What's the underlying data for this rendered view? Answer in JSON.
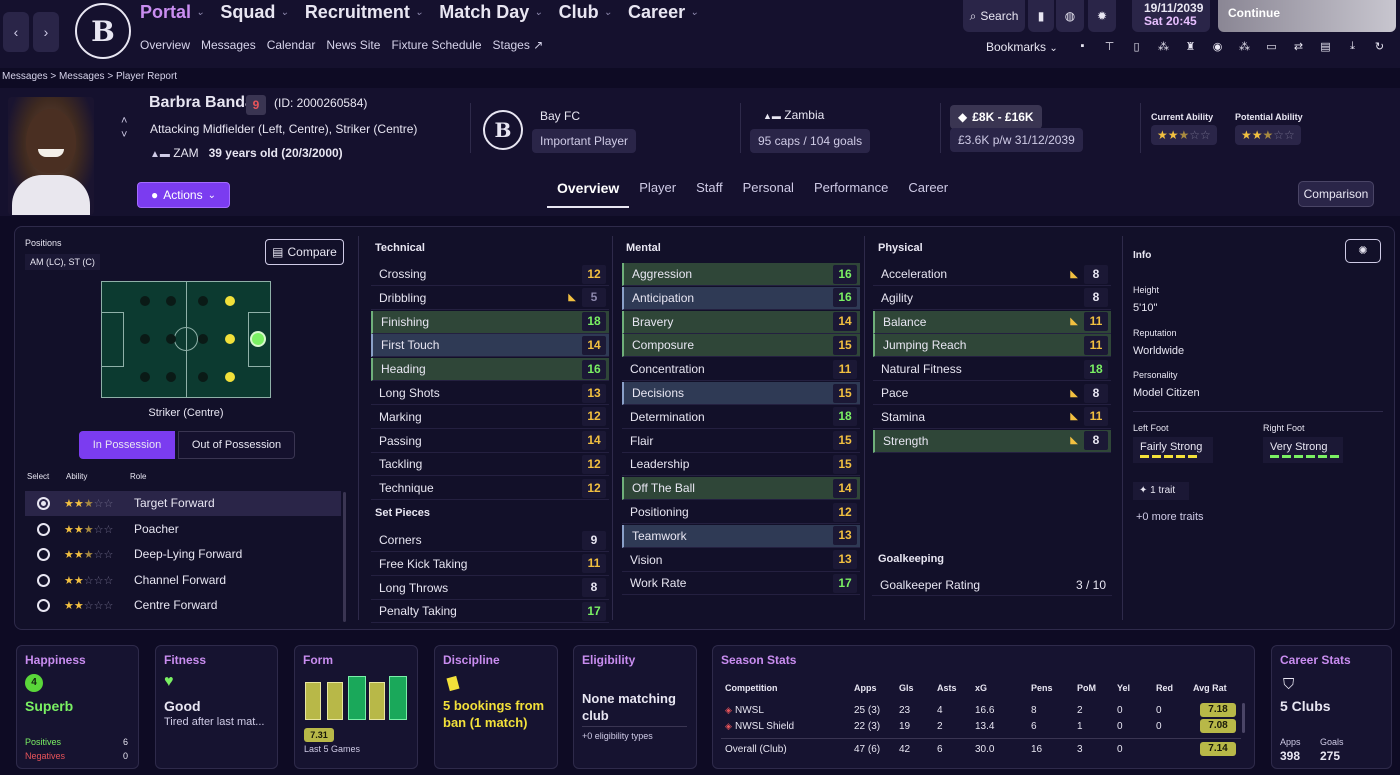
{
  "nav": {
    "main": [
      "Portal",
      "Squad",
      "Recruitment",
      "Match Day",
      "Club",
      "Career"
    ],
    "sub": [
      "Overview",
      "Messages",
      "Calendar",
      "News Site",
      "Fixture Schedule",
      "Stages"
    ],
    "search": "Search",
    "date": "19/11/2039",
    "day_time": "Sat 20:45",
    "continue": "Continue",
    "bookmarks": "Bookmarks",
    "breadcrumb": "Messages  >  Messages  >  Player Report",
    "club_logo": "B"
  },
  "player": {
    "name": "Barbra Banda",
    "number": "9",
    "id": "(ID: 2000260584)",
    "positions": "Attacking Midfielder (Left, Centre), Striker (Centre)",
    "nation_code": "ZAM",
    "age": "39 years old (20/3/2000)",
    "club": "Bay FC",
    "status": "Important Player",
    "nation": "Zambia",
    "caps": "95 caps / 104 goals",
    "value": "£8K - £16K",
    "wage": "£3.6K p/w 31/12/2039",
    "ca_label": "Current Ability",
    "pa_label": "Potential Ability",
    "ca_stars": 2.5,
    "pa_stars": 2.5
  },
  "actions": "Actions",
  "tabs": [
    "Overview",
    "Player",
    "Staff",
    "Personal",
    "Performance",
    "Career"
  ],
  "comparison": "Comparison",
  "positions_panel": {
    "title": "Positions",
    "code": "AM (LC), ST (C)",
    "compare": "Compare",
    "selected": "Striker (Centre)",
    "in_possession": "In Possession",
    "out_possession": "Out of Possession",
    "col_select": "Select",
    "col_ability": "Ability",
    "col_role": "Role",
    "roles": [
      {
        "name": "Target Forward",
        "stars": 2.5,
        "selected": true
      },
      {
        "name": "Poacher",
        "stars": 2.5,
        "selected": false
      },
      {
        "name": "Deep-Lying Forward",
        "stars": 2.5,
        "selected": false
      },
      {
        "name": "Channel Forward",
        "stars": 2,
        "selected": false
      },
      {
        "name": "Centre Forward",
        "stars": 2,
        "selected": false
      }
    ]
  },
  "technical": {
    "title": "Technical",
    "rows": [
      [
        "Crossing",
        "12"
      ],
      [
        "Dribbling",
        "5"
      ],
      [
        "Finishing",
        "18"
      ],
      [
        "First Touch",
        "14"
      ],
      [
        "Heading",
        "16"
      ],
      [
        "Long Shots",
        "13"
      ],
      [
        "Marking",
        "12"
      ],
      [
        "Passing",
        "14"
      ],
      [
        "Tackling",
        "12"
      ],
      [
        "Technique",
        "12"
      ]
    ]
  },
  "set_pieces": {
    "title": "Set Pieces",
    "rows": [
      [
        "Corners",
        "9"
      ],
      [
        "Free Kick Taking",
        "11"
      ],
      [
        "Long Throws",
        "8"
      ],
      [
        "Penalty Taking",
        "17"
      ]
    ]
  },
  "mental": {
    "title": "Mental",
    "rows": [
      [
        "Aggression",
        "16"
      ],
      [
        "Anticipation",
        "16"
      ],
      [
        "Bravery",
        "14"
      ],
      [
        "Composure",
        "15"
      ],
      [
        "Concentration",
        "11"
      ],
      [
        "Decisions",
        "15"
      ],
      [
        "Determination",
        "18"
      ],
      [
        "Flair",
        "15"
      ],
      [
        "Leadership",
        "15"
      ],
      [
        "Off The Ball",
        "14"
      ],
      [
        "Positioning",
        "12"
      ],
      [
        "Teamwork",
        "13"
      ],
      [
        "Vision",
        "13"
      ],
      [
        "Work Rate",
        "17"
      ]
    ]
  },
  "physical": {
    "title": "Physical",
    "rows": [
      [
        "Acceleration",
        "8"
      ],
      [
        "Agility",
        "8"
      ],
      [
        "Balance",
        "11"
      ],
      [
        "Jumping Reach",
        "11"
      ],
      [
        "Natural Fitness",
        "18"
      ],
      [
        "Pace",
        "8"
      ],
      [
        "Stamina",
        "11"
      ],
      [
        "Strength",
        "8"
      ]
    ]
  },
  "goalkeeping": {
    "title": "Goalkeeping",
    "label": "Goalkeeper Rating",
    "value": "3 / 10"
  },
  "info": {
    "title": "Info",
    "height_label": "Height",
    "height": "5'10\"",
    "rep_label": "Reputation",
    "rep": "Worldwide",
    "pers_label": "Personality",
    "pers": "Model Citizen",
    "lf_label": "Left Foot",
    "lf": "Fairly Strong",
    "rf_label": "Right Foot",
    "rf": "Very Strong",
    "trait": "1 trait",
    "more_traits": "+0 more traits"
  },
  "cards": {
    "happiness": {
      "title": "Happiness",
      "value": "Superb",
      "icon_text": "4",
      "pos_label": "Positives",
      "pos": "6",
      "neg_label": "Negatives",
      "neg": "0"
    },
    "fitness": {
      "title": "Fitness",
      "value": "Good",
      "sub": "Tired after last mat..."
    },
    "form": {
      "title": "Form",
      "rating": "7.31",
      "sub": "Last 5 Games"
    },
    "discipline": {
      "title": "Discipline",
      "value": "5 bookings from ban (1 match)"
    },
    "eligibility": {
      "title": "Eligibility",
      "value": "None matching club",
      "sub": "+0 eligibility types"
    },
    "season": {
      "title": "Season Stats",
      "headers": [
        "Competition",
        "Apps",
        "Gls",
        "Asts",
        "xG",
        "Pens",
        "PoM",
        "Yel",
        "Red",
        "Avg Rat"
      ],
      "rows": [
        [
          "NWSL",
          "25 (3)",
          "23",
          "4",
          "16.6",
          "8",
          "2",
          "0",
          "0",
          "7.18"
        ],
        [
          "NWSL Shield",
          "22 (3)",
          "19",
          "2",
          "13.4",
          "6",
          "1",
          "0",
          "0",
          "7.08"
        ],
        [
          "Overall (Club)",
          "47 (6)",
          "42",
          "6",
          "30.0",
          "16",
          "3",
          "0",
          "",
          "7.14"
        ]
      ]
    },
    "career": {
      "title": "Career Stats",
      "clubs": "5 Clubs",
      "apps_label": "Apps",
      "apps": "398",
      "goals_label": "Goals",
      "goals": "275"
    }
  }
}
